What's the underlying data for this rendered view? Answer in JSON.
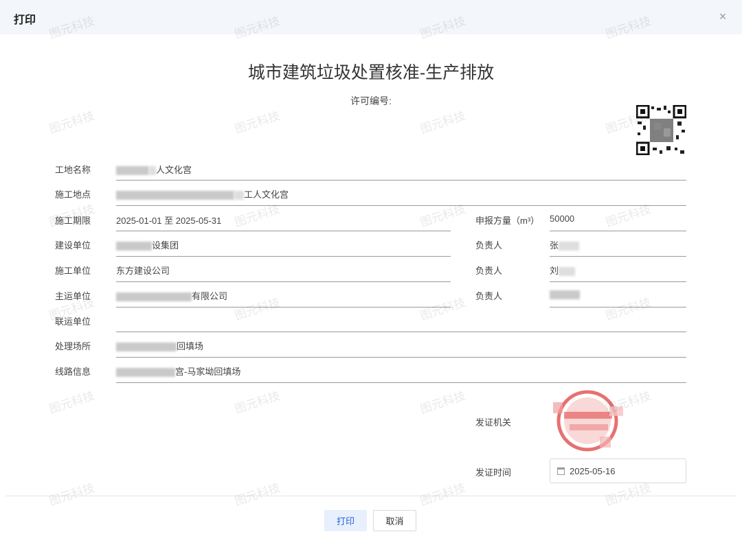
{
  "dialog": {
    "title": "打印",
    "close_icon": "×"
  },
  "watermark_text": "图元科技",
  "document": {
    "title": "城市建筑垃圾处置核准-生产排放",
    "permit_label": "许可编号:",
    "permit_value": ""
  },
  "fields": {
    "site_name": {
      "label": "工地名称",
      "value": "人文化宫"
    },
    "site_address": {
      "label": "施工地点",
      "value": "工人文化宫"
    },
    "period": {
      "label": "施工期限",
      "value": "2025-01-01 至 2025-05-31"
    },
    "volume": {
      "label": "申报方量（m³）",
      "value": "50000"
    },
    "builder": {
      "label": "建设单位",
      "value": "设集团"
    },
    "builder_contact": {
      "label": "负责人",
      "value": "张"
    },
    "contractor": {
      "label": "施工单位",
      "value": "东方建设公司"
    },
    "contractor_contact": {
      "label": "负责人",
      "value": "刘"
    },
    "main_transport": {
      "label": "主运单位",
      "value": "有限公司"
    },
    "main_transport_contact": {
      "label": "负责人",
      "value": ""
    },
    "joint_transport": {
      "label": "联运单位",
      "value": ""
    },
    "disposal_site": {
      "label": "处理场所",
      "value": "回填场"
    },
    "route": {
      "label": "线路信息",
      "value": "宫-马家坳回填场"
    }
  },
  "issuer": {
    "label": "发证机关"
  },
  "issue_date": {
    "label": "发证时间",
    "value": "2025-05-16",
    "icon": "calendar-icon"
  },
  "footer": {
    "print_label": "打印",
    "cancel_label": "取消"
  },
  "colors": {
    "header_bg": "#f3f6fb",
    "primary": "#2a62d6",
    "primary_light": "#e8effd",
    "seal": "#e04040"
  }
}
